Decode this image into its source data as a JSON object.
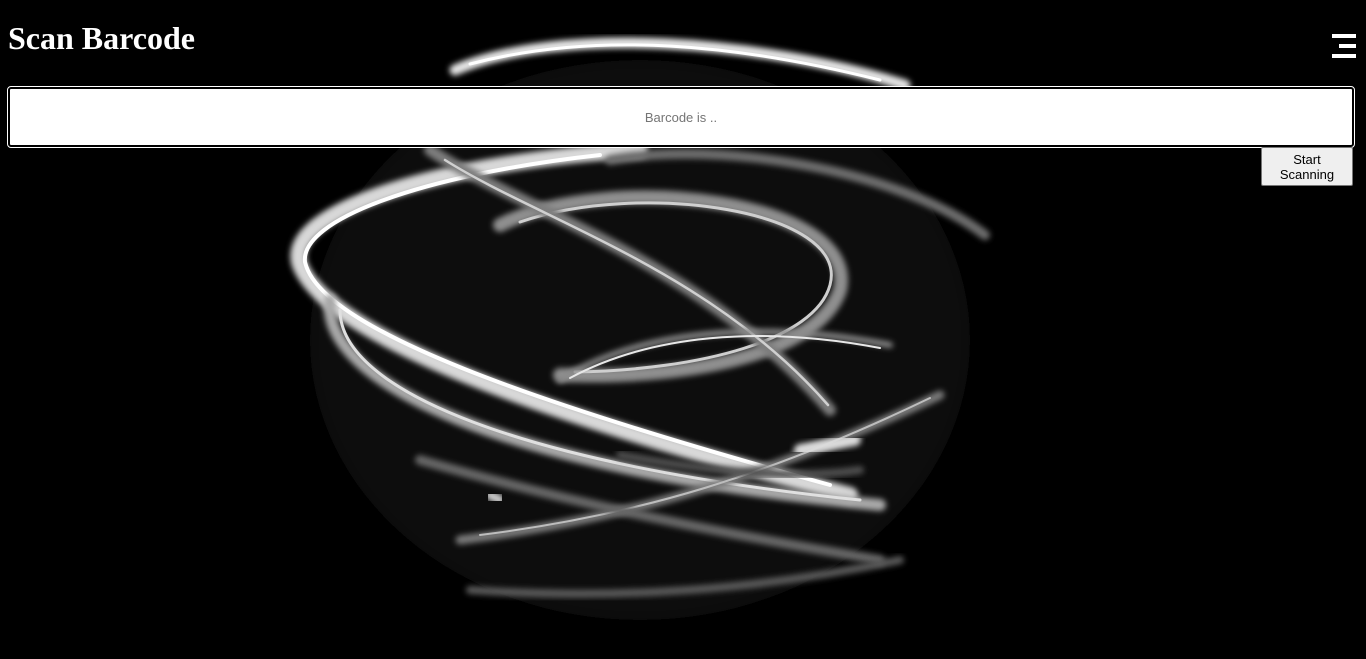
{
  "header": {
    "title": "Scan Barcode",
    "menu_icon": "hamburger-menu-icon"
  },
  "scanner": {
    "barcode_value": "",
    "barcode_placeholder": "Barcode is ..",
    "start_button_label": "Start Scanning"
  },
  "background": {
    "description_icon": "abstract-light-ribbon-art",
    "base_color": "#000000",
    "stroke_color": "#ffffff"
  }
}
